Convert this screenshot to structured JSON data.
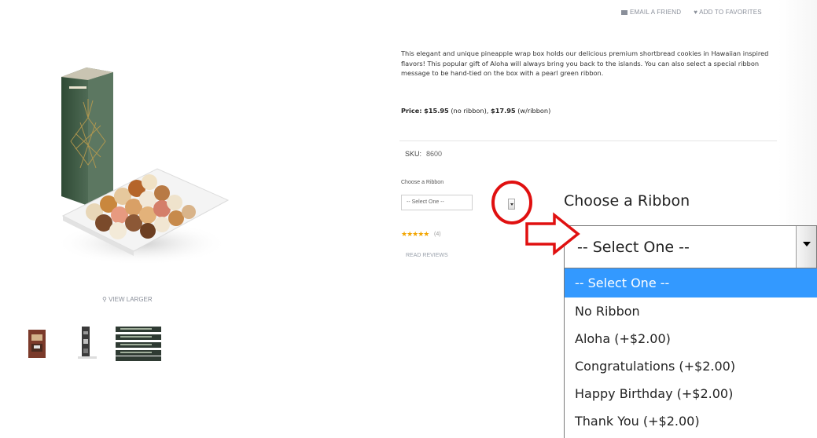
{
  "top_links": {
    "email": "EMAIL A FRIEND",
    "favorites": "ADD TO FAVORITES"
  },
  "product": {
    "description": "This elegant and unique pineapple wrap box holds our delicious premium shortbread cookies in Hawaiian inspired flavors! This popular gift of Aloha will always bring you back to the islands. You can also select a special ribbon message to be hand-tied on the box with a pearl green ribbon.",
    "price_label": "Price:",
    "price_plain": "$15.95",
    "price_plain_note": "(no ribbon),",
    "price_ribbon": "$17.95",
    "price_ribbon_note": "(w/ribbon)",
    "sku_label": "SKU:",
    "sku_value": "8600",
    "ribbon_label": "Choose a Ribbon",
    "ribbon_select_value": "-- Select One --",
    "rating_stars": "★★★★★",
    "rating_count": "(4)",
    "read_reviews": "READ REVIEWS",
    "view_larger": "VIEW LARGER"
  },
  "zoomed_dropdown": {
    "label": "Choose a Ribbon",
    "selected": "-- Select One --",
    "options": [
      "-- Select One --",
      "No Ribbon",
      "Aloha (+$2.00)",
      "Congratulations (+$2.00)",
      "Happy Birthday (+$2.00)",
      "Thank You (+$2.00)"
    ],
    "highlight_color": "#3399ff"
  },
  "annotation": {
    "color": "#e01010",
    "shapes": [
      "circle",
      "arrow"
    ]
  },
  "colors": {
    "star": "#f2a500",
    "link_gray": "#8a8f9a"
  },
  "icons": [
    "envelope-icon",
    "heart-icon",
    "magnifier-icon",
    "dropdown-arrow-icon",
    "star-icon"
  ]
}
